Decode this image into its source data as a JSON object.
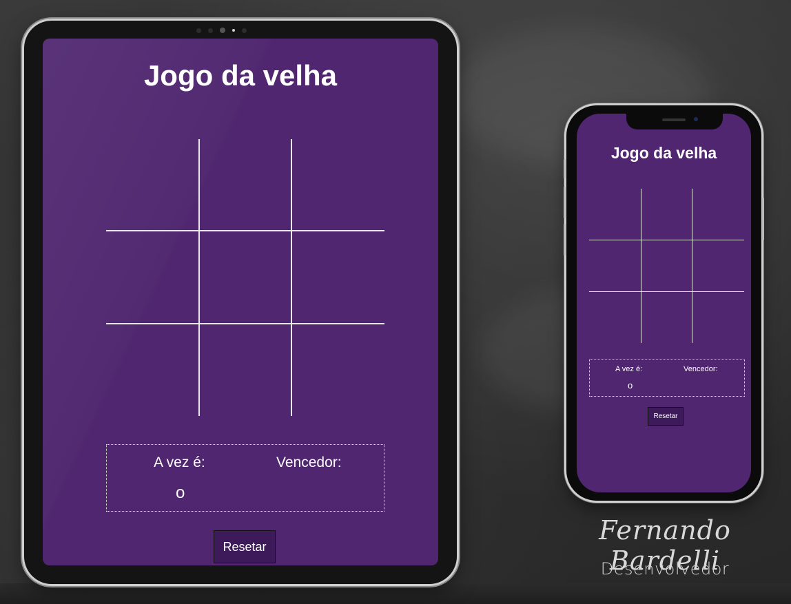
{
  "game": {
    "title": "Jogo da velha",
    "turn_label": "A vez é:",
    "turn_value": "o",
    "winner_label": "Vencedor:",
    "winner_value": "",
    "reset_label": "Resetar",
    "board": [
      "",
      "",
      "",
      "",
      "",
      "",
      "",
      "",
      ""
    ]
  },
  "signature": {
    "name": "Fernando Bardelli",
    "role": "Desenvolvedor"
  },
  "colors": {
    "app_background": "#4f266f",
    "button_background": "#3d1a5a",
    "line": "#e8e8e8"
  }
}
